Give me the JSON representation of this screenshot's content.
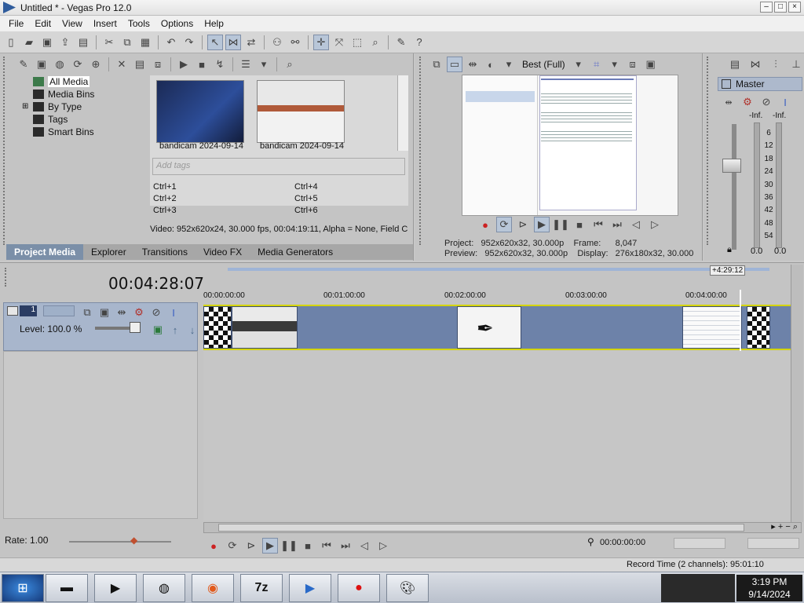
{
  "window": {
    "title": "Untitled * - Vegas Pro 12.0"
  },
  "menu": [
    "File",
    "Edit",
    "View",
    "Insert",
    "Tools",
    "Options",
    "Help"
  ],
  "explorer": {
    "tree": [
      {
        "label": "All Media",
        "selected": true
      },
      {
        "label": "Media Bins"
      },
      {
        "label": "By Type"
      },
      {
        "label": "Tags"
      },
      {
        "label": "Smart Bins"
      }
    ],
    "thumbnails": [
      {
        "caption": "bandicam 2024-09-14"
      },
      {
        "caption": "bandicam 2024-09-14"
      }
    ],
    "tags_placeholder": "Add tags",
    "shortcuts": [
      "Ctrl+1",
      "Ctrl+2",
      "Ctrl+3",
      "Ctrl+4",
      "Ctrl+5",
      "Ctrl+6"
    ],
    "media_info": "Video: 952x620x24, 30.000 fps, 00:04:19:11, Alpha = None, Field C",
    "tabs": [
      "Project Media",
      "Explorer",
      "Transitions",
      "Video FX",
      "Media Generators"
    ]
  },
  "preview": {
    "quality": "Best (Full)",
    "project_line": "Project:   952x620x32, 30.000p    Frame:      8,047",
    "preview_line": "Preview:   952x620x32, 30.000p    Display:   276x180x32, 30.000"
  },
  "master": {
    "title": "Master",
    "inf_left": "-Inf.",
    "inf_right": "-Inf.",
    "scale": [
      "6",
      "12",
      "18",
      "24",
      "30",
      "36",
      "42",
      "48",
      "54"
    ],
    "readout_left": "0.0",
    "readout_right": "0.0"
  },
  "timeline": {
    "time_display": "00:04:28:07",
    "track_number": "1",
    "level": "Level: 100.0 %",
    "ruler_ticks": [
      "00:00:00:00",
      "00:01:00:00",
      "00:02:00:00",
      "00:03:00:00",
      "00:04:00:00"
    ],
    "end_marker": "+4:29:12",
    "rate": "Rate: 1.00",
    "timecode": "00:00:00:00"
  },
  "status": {
    "record_time": "Record Time (2 channels): 95:01:10"
  },
  "taskbar": {
    "time": "3:19 PM",
    "date": "9/14/2024",
    "apps": [
      "windows-start",
      "terminal",
      "media-player",
      "globe",
      "firefox",
      "7zip",
      "vegas-player",
      "bandicam-record",
      "paint"
    ],
    "labels": {
      "7zip": "7z"
    }
  },
  "colors": {
    "accent": "#7b8fa8",
    "track": "#6d82a9",
    "highlight": "#d4d400"
  }
}
